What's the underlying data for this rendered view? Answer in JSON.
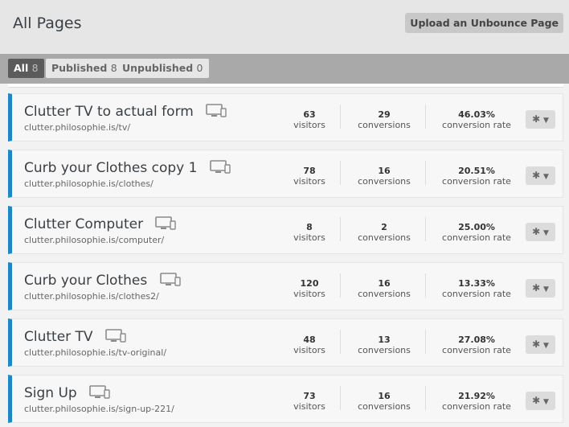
{
  "header": {
    "title": "All Pages",
    "upload_label": "Upload an Unbounce Page"
  },
  "tabs": [
    {
      "label": "All",
      "count": "8"
    },
    {
      "label": "Published",
      "count": "8"
    },
    {
      "label": "Unpublished",
      "count": "0"
    }
  ],
  "colors": {
    "accent": "#1e88c7",
    "header_bg": "#e6e6e6",
    "filterbar_bg": "#a9a9a9"
  },
  "icons": {
    "device": "desktop-mobile-icon",
    "gear": "gear-icon",
    "caret": "caret-down-icon"
  },
  "stat_labels": {
    "visitors": "visitors",
    "conversions": "conversions",
    "rate": "conversion rate"
  },
  "pages": [
    {
      "name": "Clutter TV to actual form",
      "url": "clutter.philosophie.is/tv/",
      "visitors": "63",
      "conversions": "29",
      "rate": "46.03%"
    },
    {
      "name": "Curb your Clothes copy 1",
      "url": "clutter.philosophie.is/clothes/",
      "visitors": "78",
      "conversions": "16",
      "rate": "20.51%"
    },
    {
      "name": "Clutter Computer",
      "url": "clutter.philosophie.is/computer/",
      "visitors": "8",
      "conversions": "2",
      "rate": "25.00%"
    },
    {
      "name": "Curb your Clothes",
      "url": "clutter.philosophie.is/clothes2/",
      "visitors": "120",
      "conversions": "16",
      "rate": "13.33%"
    },
    {
      "name": "Clutter TV",
      "url": "clutter.philosophie.is/tv-original/",
      "visitors": "48",
      "conversions": "13",
      "rate": "27.08%"
    },
    {
      "name": "Sign Up",
      "url": "clutter.philosophie.is/sign-up-221/",
      "visitors": "73",
      "conversions": "16",
      "rate": "21.92%"
    }
  ]
}
